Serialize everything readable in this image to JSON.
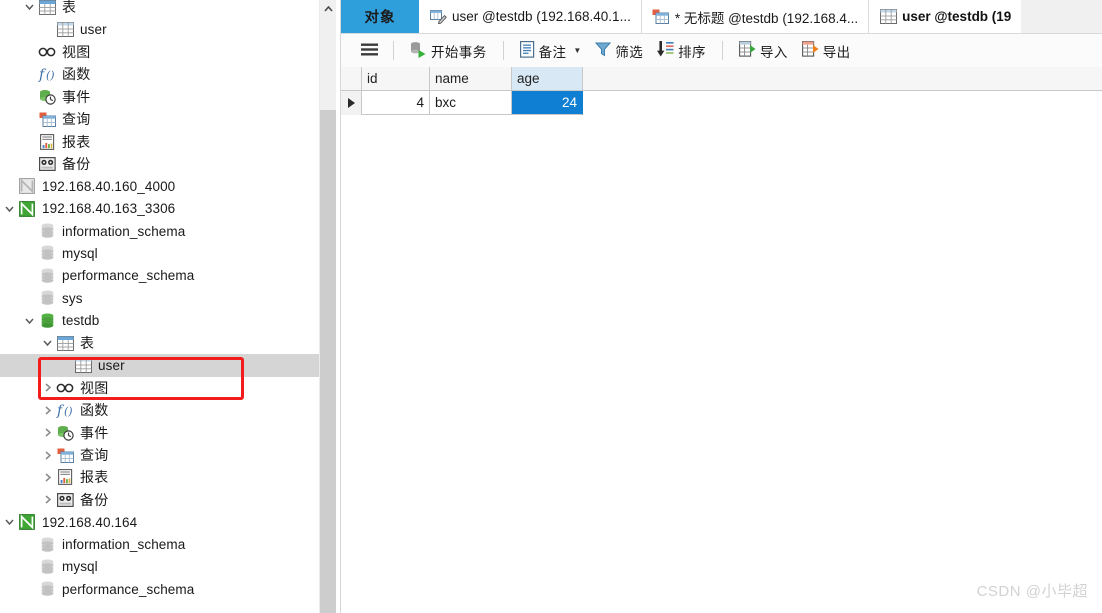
{
  "sidebar": {
    "tree": [
      {
        "indent": 1,
        "twisty": "down",
        "icon": "table-folder-icon",
        "label": "表",
        "selected": false,
        "cn": true
      },
      {
        "indent": 2,
        "twisty": "none",
        "icon": "table-icon",
        "label": "user",
        "selected": false,
        "cn": false
      },
      {
        "indent": 1,
        "twisty": "none",
        "icon": "view-icon",
        "label": "视图",
        "selected": false,
        "cn": true
      },
      {
        "indent": 1,
        "twisty": "none",
        "icon": "function-icon",
        "label": "函数",
        "selected": false,
        "cn": true
      },
      {
        "indent": 1,
        "twisty": "none",
        "icon": "event-icon",
        "label": "事件",
        "selected": false,
        "cn": true
      },
      {
        "indent": 1,
        "twisty": "none",
        "icon": "query-icon",
        "label": "查询",
        "selected": false,
        "cn": true
      },
      {
        "indent": 1,
        "twisty": "none",
        "icon": "report-icon",
        "label": "报表",
        "selected": false,
        "cn": true
      },
      {
        "indent": 1,
        "twisty": "none",
        "icon": "backup-icon",
        "label": "备份",
        "selected": false,
        "cn": true
      },
      {
        "indent": 0,
        "twisty": "none",
        "icon": "connection-gray-icon",
        "label": "192.168.40.160_4000",
        "selected": false,
        "cn": false
      },
      {
        "indent": 0,
        "twisty": "down",
        "icon": "connection-green-icon",
        "label": "192.168.40.163_3306",
        "selected": false,
        "cn": false
      },
      {
        "indent": 1,
        "twisty": "none",
        "icon": "database-gray-icon",
        "label": "information_schema",
        "selected": false,
        "cn": false
      },
      {
        "indent": 1,
        "twisty": "none",
        "icon": "database-gray-icon",
        "label": "mysql",
        "selected": false,
        "cn": false
      },
      {
        "indent": 1,
        "twisty": "none",
        "icon": "database-gray-icon",
        "label": "performance_schema",
        "selected": false,
        "cn": false
      },
      {
        "indent": 1,
        "twisty": "none",
        "icon": "database-gray-icon",
        "label": "sys",
        "selected": false,
        "cn": false
      },
      {
        "indent": 1,
        "twisty": "down",
        "icon": "database-green-icon",
        "label": "testdb",
        "selected": false,
        "cn": false
      },
      {
        "indent": 2,
        "twisty": "down",
        "icon": "table-folder-icon",
        "label": "表",
        "selected": false,
        "cn": true
      },
      {
        "indent": 3,
        "twisty": "none",
        "icon": "table-icon",
        "label": "user",
        "selected": true,
        "cn": false
      },
      {
        "indent": 2,
        "twisty": "right",
        "icon": "view-icon",
        "label": "视图",
        "selected": false,
        "cn": true
      },
      {
        "indent": 2,
        "twisty": "right",
        "icon": "function-icon",
        "label": "函数",
        "selected": false,
        "cn": true
      },
      {
        "indent": 2,
        "twisty": "right",
        "icon": "event-icon",
        "label": "事件",
        "selected": false,
        "cn": true
      },
      {
        "indent": 2,
        "twisty": "right",
        "icon": "query-icon",
        "label": "查询",
        "selected": false,
        "cn": true
      },
      {
        "indent": 2,
        "twisty": "right",
        "icon": "report-icon",
        "label": "报表",
        "selected": false,
        "cn": true
      },
      {
        "indent": 2,
        "twisty": "right",
        "icon": "backup-icon",
        "label": "备份",
        "selected": false,
        "cn": true
      },
      {
        "indent": 0,
        "twisty": "down",
        "icon": "connection-green-icon",
        "label": "192.168.40.164",
        "selected": false,
        "cn": false
      },
      {
        "indent": 1,
        "twisty": "none",
        "icon": "database-gray-icon",
        "label": "information_schema",
        "selected": false,
        "cn": false
      },
      {
        "indent": 1,
        "twisty": "none",
        "icon": "database-gray-icon",
        "label": "mysql",
        "selected": false,
        "cn": false
      },
      {
        "indent": 1,
        "twisty": "none",
        "icon": "database-gray-icon",
        "label": "performance_schema",
        "selected": false,
        "cn": false
      }
    ]
  },
  "tabs": [
    {
      "label": "对象",
      "icon": "none",
      "kind": "object"
    },
    {
      "label": "user @testdb (192.168.40.1...",
      "icon": "designer-icon",
      "kind": "normal"
    },
    {
      "label": "* 无标题 @testdb (192.168.4...",
      "icon": "query-icon",
      "kind": "normal"
    },
    {
      "label": "user @testdb (19",
      "icon": "table-icon",
      "kind": "current"
    }
  ],
  "toolbar": {
    "menu_icon": "hamburger-icon",
    "buttons": [
      {
        "label": "开始事务",
        "icon": "begin-transaction-icon",
        "caret": false
      },
      {
        "label": "备注",
        "icon": "note-icon",
        "caret": true
      },
      {
        "label": "筛选",
        "icon": "filter-icon",
        "caret": false
      },
      {
        "label": "排序",
        "icon": "sort-icon",
        "caret": false
      },
      {
        "label": "导入",
        "icon": "import-icon",
        "caret": false
      },
      {
        "label": "导出",
        "icon": "export-icon",
        "caret": false
      }
    ]
  },
  "grid": {
    "columns": [
      "id",
      "name",
      "age"
    ],
    "selected_column": "age",
    "rows": [
      {
        "marker": "current-row-marker",
        "id": "4",
        "name": "bxc",
        "age": "24"
      }
    ]
  },
  "annotation": {
    "name": "red-highlight-box",
    "color": "#f41b1b"
  },
  "watermark": {
    "text": "CSDN @小毕超"
  }
}
